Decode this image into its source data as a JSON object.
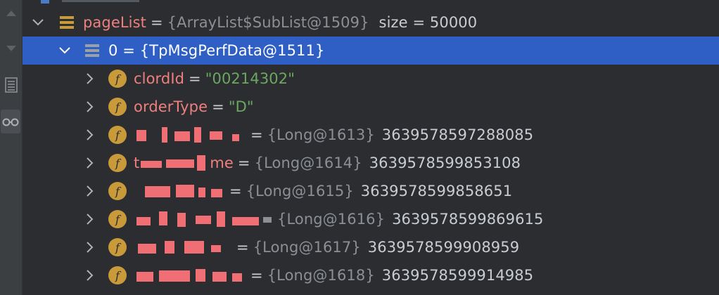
{
  "tree": {
    "page_list": {
      "name": "pageList",
      "type_ref": "{ArrayList$SubList@1509}",
      "size_text": "size = 50000"
    },
    "selected_item": {
      "label": "0 = {TpMsgPerfData@1511}"
    },
    "fields": [
      {
        "name": "clordId",
        "string_value": "\"00214302\""
      },
      {
        "name": "orderType",
        "string_value": "\"D\""
      },
      {
        "name_visible": "",
        "ref": "{Long@1613}",
        "value": "3639578597288085"
      },
      {
        "name_visible": "t",
        "name_tail": "me",
        "ref": "{Long@1614}",
        "value": "3639578599853108"
      },
      {
        "name_visible": "",
        "ref": "{Long@1615}",
        "value": "3639578599858651"
      },
      {
        "name_visible": "",
        "ref": "{Long@1616}",
        "value": "3639578599869615"
      },
      {
        "name_visible": "",
        "ref": "{Long@1617}",
        "value": "3639578599908959"
      },
      {
        "name_visible": "",
        "ref": "{Long@1618}",
        "value": "3639578599914985"
      }
    ],
    "badge_letter": "f"
  },
  "colors": {
    "background": "#2b2d30",
    "selection": "#2f5fc4",
    "field_name": "#f07f7f",
    "string_value": "#6ba760",
    "reference": "#8c8f94",
    "badge": "#c89a3a",
    "redaction": "#ef6f74"
  },
  "icons": {
    "gutter": [
      "arrow-up-icon",
      "arrow-down-icon",
      "list-view-icon",
      "glasses-icon"
    ],
    "tree": [
      "chevron-down-icon",
      "chevron-right-icon",
      "list-icon",
      "field-icon"
    ]
  }
}
